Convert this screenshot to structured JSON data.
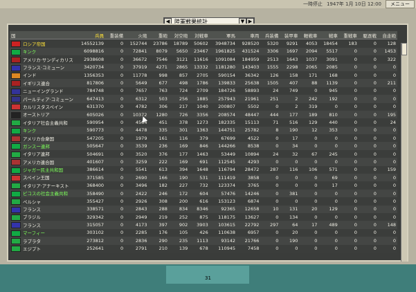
{
  "top": {
    "label": "一時停止",
    "date": "1947年 1月 10日 12:00",
    "menu": "メニュー"
  },
  "title": "陸軍戦果統計",
  "page_number": "31",
  "headers": [
    "国",
    "兵員",
    "重装備",
    "火砲",
    "重砲",
    "対空砲",
    "対戦車",
    "軍馬",
    "車両",
    "兵装備",
    "装甲車",
    "軽戦車",
    "戦車",
    "重戦車",
    "駆逐戦",
    "自走砲"
  ],
  "rows": [
    {
      "flag": "#c22",
      "name": "ロシア帝国",
      "color": "y",
      "v": [
        "14552139",
        "0",
        "152744",
        "23786",
        "18789",
        "50602",
        "3948734",
        "928520",
        "5320",
        "9291",
        "4053",
        "18454",
        "183",
        "0",
        "128"
      ]
    },
    {
      "flag": "#1a4",
      "name": "キンク",
      "color": "g",
      "v": [
        "6098816",
        "0",
        "72841",
        "8079",
        "5650",
        "23467",
        "1961825",
        "431524",
        "3306",
        "1697",
        "2094",
        "5517",
        "0",
        "0",
        "1453"
      ]
    },
    {
      "flag": "#a22",
      "name": "アメリカ·サンディカリス",
      "color": "",
      "v": [
        "2938608",
        "0",
        "36672",
        "7546",
        "3121",
        "11616",
        "1091084",
        "184959",
        "2513",
        "1643",
        "1037",
        "3091",
        "0",
        "0",
        "322"
      ]
    },
    {
      "flag": "#33a",
      "name": "フランス·コミューン",
      "color": "",
      "v": [
        "3420734",
        "0",
        "37919",
        "4271",
        "2865",
        "13332",
        "1181280",
        "143403",
        "1555",
        "2298",
        "2065",
        "2085",
        "0",
        "0",
        "0"
      ]
    },
    {
      "flag": "#d82",
      "name": "インド",
      "color": "",
      "v": [
        "1356353",
        "0",
        "11778",
        "998",
        "857",
        "2705",
        "590154",
        "36342",
        "126",
        "158",
        "171",
        "168",
        "0",
        "0",
        "0"
      ]
    },
    {
      "flag": "#a22",
      "name": "イギリス連合",
      "color": "",
      "v": [
        "817806",
        "0",
        "5649",
        "677",
        "498",
        "1786",
        "139833",
        "25638",
        "1505",
        "407",
        "88",
        "1139",
        "0",
        "0",
        "211"
      ]
    },
    {
      "flag": "#339",
      "name": "ニューイングランド",
      "color": "",
      "v": [
        "784748",
        "0",
        "7657",
        "763",
        "724",
        "2709",
        "184726",
        "58893",
        "24",
        "749",
        "0",
        "945",
        "0",
        "0",
        "0"
      ]
    },
    {
      "flag": "#338",
      "name": "パールティア·コミューン",
      "color": "",
      "v": [
        "647413",
        "0",
        "6312",
        "503",
        "256",
        "1885",
        "257943",
        "21961",
        "251",
        "2",
        "242",
        "192",
        "0",
        "0",
        "0"
      ]
    },
    {
      "flag": "#c33",
      "name": "カルリスタスペイン",
      "color": "",
      "v": [
        "631370",
        "0",
        "4782",
        "306",
        "217",
        "1040",
        "200807",
        "5502",
        "0",
        "2",
        "319",
        "0",
        "0",
        "0",
        "0"
      ]
    },
    {
      "flag": "#222",
      "name": "オーストリア",
      "color": "",
      "v": [
        "605026",
        "0",
        "10372",
        "1280",
        "726",
        "3356",
        "208574",
        "48447",
        "444",
        "177",
        "189",
        "810",
        "0",
        "0",
        "195"
      ]
    },
    {
      "flag": "#2a4",
      "name": "イタリア社会主義共和",
      "color": "",
      "v": [
        "590954",
        "0",
        "4564",
        "451",
        "378",
        "1273",
        "182335",
        "15113",
        "71",
        "516",
        "129",
        "440",
        "0",
        "0",
        "24"
      ]
    },
    {
      "flag": "#1a4",
      "name": "キンク",
      "color": "g",
      "v": [
        "590773",
        "0",
        "4478",
        "335",
        "301",
        "1363",
        "144751",
        "25782",
        "8",
        "190",
        "12",
        "353",
        "0",
        "0",
        "0"
      ]
    },
    {
      "flag": "#a33",
      "name": "アメリカ合衆国",
      "color": "",
      "v": [
        "547205",
        "0",
        "1979",
        "161",
        "116",
        "379",
        "67699",
        "4522",
        "0",
        "17",
        "0",
        "0",
        "0",
        "0",
        "0"
      ]
    },
    {
      "flag": "#1a4",
      "name": "ガンスー連邦",
      "color": "g",
      "v": [
        "505647",
        "0",
        "3539",
        "236",
        "169",
        "846",
        "144266",
        "8538",
        "0",
        "34",
        "0",
        "0",
        "0",
        "0",
        "0"
      ]
    },
    {
      "flag": "#2a4",
      "name": "イタリア連邦",
      "color": "",
      "v": [
        "504691",
        "0",
        "3520",
        "376",
        "177",
        "1463",
        "53449",
        "10894",
        "24",
        "32",
        "67",
        "245",
        "0",
        "0",
        "0"
      ]
    },
    {
      "flag": "#a33",
      "name": "アメリカ連合国",
      "color": "",
      "v": [
        "401607",
        "0",
        "3259",
        "222",
        "169",
        "691",
        "112545",
        "4293",
        "0",
        "0",
        "0",
        "0",
        "0",
        "0",
        "0"
      ]
    },
    {
      "flag": "#1a4",
      "name": "ジャガー民主共和国",
      "color": "g",
      "v": [
        "386614",
        "0",
        "5541",
        "613",
        "394",
        "1648",
        "116794",
        "28472",
        "287",
        "116",
        "106",
        "571",
        "0",
        "0",
        "159"
      ]
    },
    {
      "flag": "#c33",
      "name": "スペイン王国",
      "color": "",
      "v": [
        "371585",
        "0",
        "2690",
        "166",
        "190",
        "531",
        "111419",
        "3858",
        "0",
        "0",
        "0",
        "69",
        "0",
        "0",
        "0"
      ]
    },
    {
      "flag": "#2a4",
      "name": "イタリア·アナーキスト",
      "color": "",
      "v": [
        "368400",
        "0",
        "3496",
        "182",
        "227",
        "732",
        "123374",
        "3765",
        "0",
        "0",
        "0",
        "17",
        "0",
        "0",
        "0"
      ]
    },
    {
      "flag": "#1a4",
      "name": "ピコスの社会主義共和",
      "color": "g",
      "v": [
        "358490",
        "0",
        "2422",
        "246",
        "172",
        "604",
        "57476",
        "14246",
        "0",
        "381",
        "0",
        "0",
        "0",
        "0",
        "0"
      ]
    },
    {
      "flag": "#2a4",
      "name": "ペルシャ",
      "color": "",
      "v": [
        "355427",
        "0",
        "2926",
        "308",
        "200",
        "616",
        "153123",
        "6874",
        "0",
        "0",
        "0",
        "0",
        "0",
        "0",
        "0"
      ]
    },
    {
      "flag": "#33a",
      "name": "フランス",
      "color": "",
      "v": [
        "338571",
        "0",
        "2843",
        "288",
        "834",
        "8346",
        "92365",
        "12658",
        "10",
        "131",
        "20",
        "129",
        "0",
        "0",
        "0"
      ]
    },
    {
      "flag": "#2a4",
      "name": "ブラジル",
      "color": "",
      "v": [
        "329342",
        "0",
        "2949",
        "219",
        "252",
        "875",
        "118175",
        "13627",
        "0",
        "134",
        "0",
        "0",
        "0",
        "0",
        "0"
      ]
    },
    {
      "flag": "#33a",
      "name": "フランス",
      "color": "",
      "v": [
        "315057",
        "0",
        "4173",
        "397",
        "902",
        "3903",
        "103615",
        "22792",
        "297",
        "64",
        "17",
        "489",
        "0",
        "0",
        "148"
      ]
    },
    {
      "flag": "#1a4",
      "name": "マーフィー",
      "color": "g",
      "v": [
        "303102",
        "0",
        "2285",
        "176",
        "105",
        "426",
        "110638",
        "6957",
        "0",
        "20",
        "0",
        "0",
        "0",
        "0",
        "0"
      ]
    },
    {
      "flag": "#2a4",
      "name": "ラプラタ",
      "color": "",
      "v": [
        "273812",
        "0",
        "2836",
        "290",
        "235",
        "1113",
        "93142",
        "21766",
        "0",
        "190",
        "0",
        "0",
        "0",
        "0",
        "0"
      ]
    },
    {
      "flag": "#2a4",
      "name": "エジプト",
      "color": "",
      "v": [
        "252641",
        "0",
        "2791",
        "210",
        "139",
        "678",
        "110945",
        "7458",
        "0",
        "0",
        "0",
        "0",
        "0",
        "0",
        "0"
      ]
    }
  ]
}
